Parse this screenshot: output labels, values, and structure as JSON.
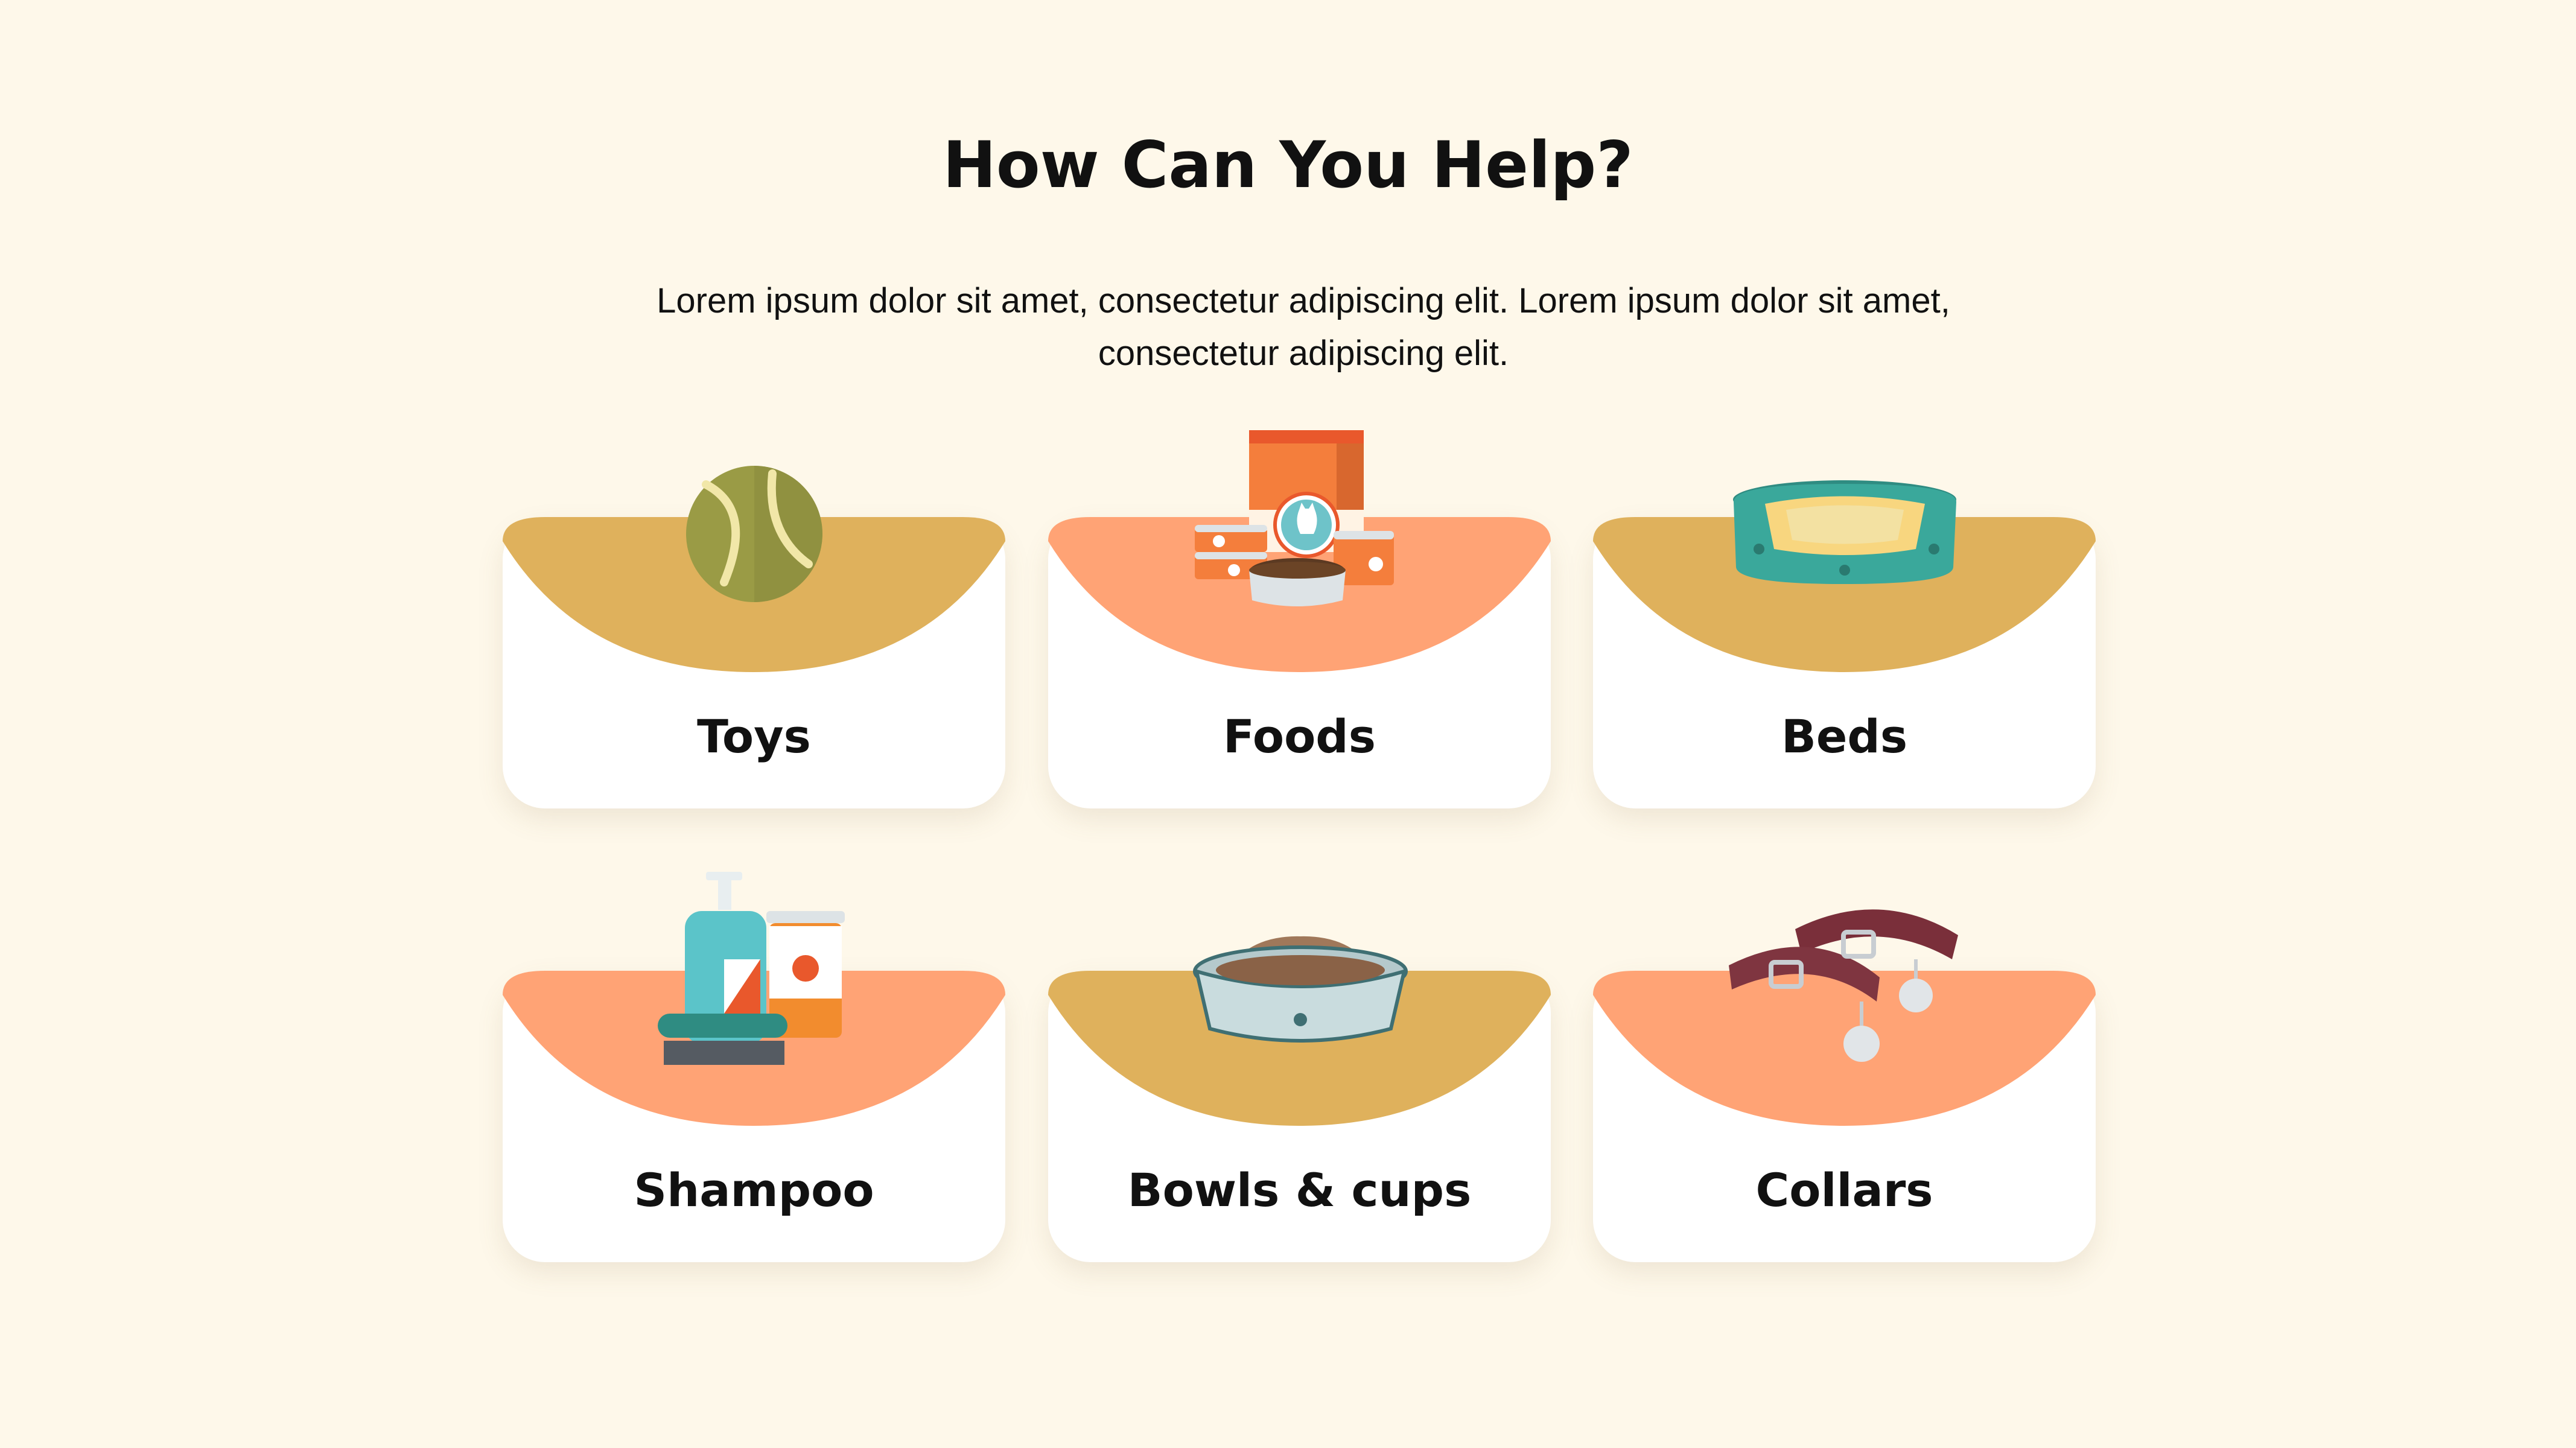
{
  "header": {
    "title": "How Can You Help?",
    "intro": "Lorem ipsum dolor sit amet, consectetur adipiscing elit. Lorem ipsum dolor sit amet, consectetur adipiscing elit."
  },
  "theme": {
    "background": "#FEF8EA",
    "card": "#FFFFFF",
    "mustard": "#DFB15C",
    "salmon": "#FFA375",
    "text": "#111111"
  },
  "categories": [
    {
      "label": "Toys",
      "accent": "#DFB15C",
      "icon": "tennis-ball-icon"
    },
    {
      "label": "Foods",
      "accent": "#FFA375",
      "icon": "pet-food-icon"
    },
    {
      "label": "Beds",
      "accent": "#DFB15C",
      "icon": "pet-bed-icon"
    },
    {
      "label": "Shampoo",
      "accent": "#FFA375",
      "icon": "shampoo-icon"
    },
    {
      "label": "Bowls & cups",
      "accent": "#DFB15C",
      "icon": "food-bowl-icon"
    },
    {
      "label": "Collars",
      "accent": "#FFA375",
      "icon": "collar-icon"
    }
  ]
}
